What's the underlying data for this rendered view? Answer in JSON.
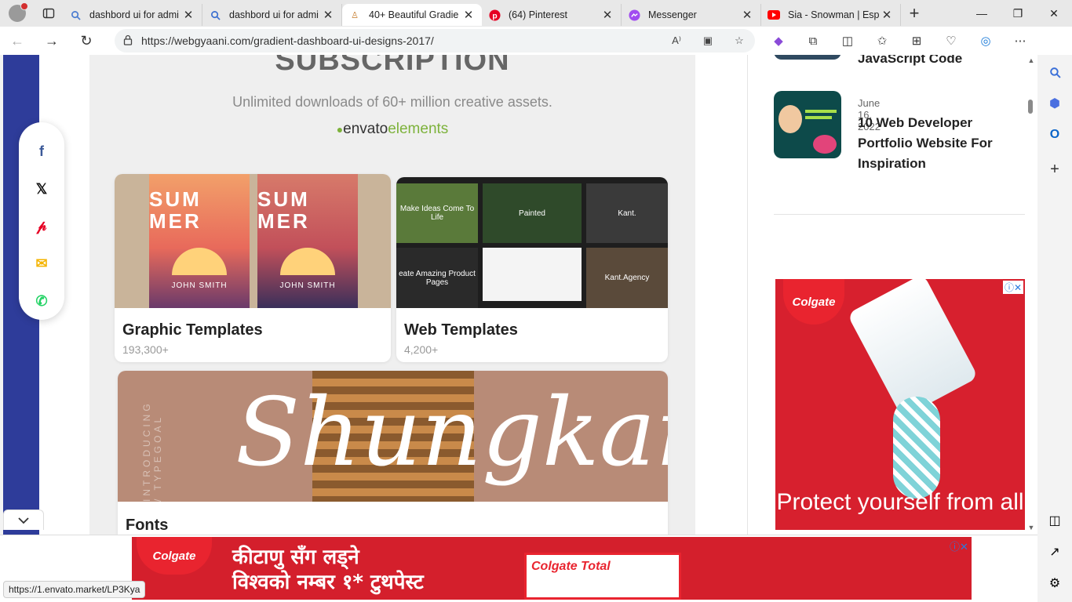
{
  "tabs": [
    {
      "title": "dashbord ui for admi",
      "favicon": "search-icon"
    },
    {
      "title": "dashbord ui for admi",
      "favicon": "search-icon"
    },
    {
      "title": "40+ Beautiful Gradie",
      "favicon": "site-icon",
      "active": true
    },
    {
      "title": "(64) Pinterest",
      "favicon": "pinterest-icon"
    },
    {
      "title": "Messenger",
      "favicon": "messenger-icon"
    },
    {
      "title": "Sia - Snowman | Espa",
      "favicon": "youtube-icon"
    }
  ],
  "address": {
    "url": "https://webgyaani.com/gradient-dashboard-ui-designs-2017/"
  },
  "page": {
    "heading": "SUBSCRIPTION",
    "tagline": "Unlimited downloads of 60+ million creative assets.",
    "brand_main": "envato",
    "brand_sub": "elements",
    "cards": [
      {
        "title": "Graphic Templates",
        "count": "193,300+"
      },
      {
        "title": "Web Templates",
        "count": "4,200+"
      },
      {
        "title": "Fonts"
      }
    ],
    "poster_text": "SUM MER",
    "poster_sub": "JOHN SMITH",
    "font_script": "Shungkara",
    "font_vertical": "INTRODUCING / TYPEGOAL",
    "web_thumbs": [
      "Make Ideas Come To Life",
      "Painted",
      "Kant.",
      "eate Amazing Product Pages",
      "",
      "Kant.Agency"
    ]
  },
  "sidebar": {
    "posts": [
      {
        "date": "",
        "title": "JavaScript Code"
      },
      {
        "date": "June 16, 2022",
        "title": "10 Web Developer Portfolio Website For Inspiration"
      }
    ],
    "ad": {
      "brand": "Colgate",
      "headline": "Protect yourself from all"
    }
  },
  "bottom_ad": {
    "brand": "Colgate",
    "line1": "कीटाणु सँग लड्ने",
    "line2": "विश्वको नम्बर १* टुथपेस्ट",
    "product": "Colgate Total"
  },
  "status": {
    "link": "https://1.envato.market/LP3Kya"
  },
  "colors": {
    "accent_blue": "#2e3c9a",
    "ad_red": "#d7202e",
    "envato_green": "#7db23b"
  }
}
